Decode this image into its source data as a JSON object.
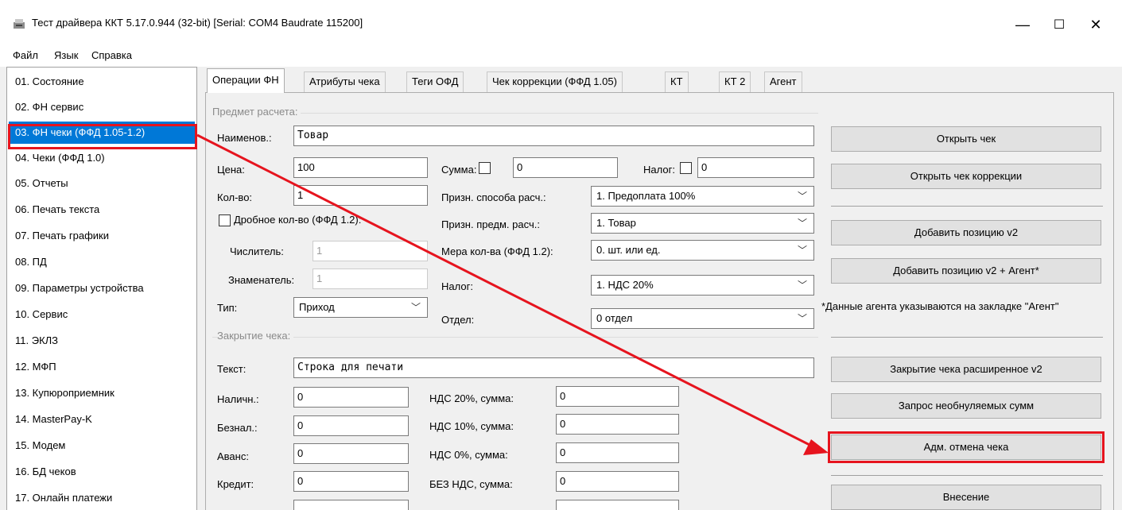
{
  "window": {
    "title": "Тест драйвера ККТ 5.17.0.944 (32-bit) [Serial: COM4 Baudrate 115200]",
    "minimize": "—",
    "maximize": "☐",
    "close": "✕"
  },
  "menu": [
    "Файл",
    "Язык",
    "Справка"
  ],
  "sidebar": [
    "01. Состояние",
    "02. ФН сервис",
    "03. ФН чеки (ФФД 1.05-1.2)",
    "04. Чеки (ФФД 1.0)",
    "05. Отчеты",
    "06. Печать текста",
    "07. Печать графики",
    "08. ПД",
    "09. Параметры устройства",
    "10. Сервис",
    "11. ЭКЛЗ",
    "12. МФП",
    "13. Купюроприемник",
    "14. MasterPay-K",
    "15. Модем",
    "16. БД чеков",
    "17. Онлайн платежи"
  ],
  "sidebar_selected": 2,
  "tabs": [
    "Операции ФН",
    "Атрибуты чека",
    "Теги ОФД",
    "Чек коррекции (ФФД 1.05)",
    "КТ",
    "КТ 2",
    "Агент"
  ],
  "subject": {
    "group": "Предмет расчета:",
    "name_label": "Наименов.:",
    "name_value": "Товар",
    "price_label": "Цена:",
    "price_value": "100",
    "sum_label": "Сумма:",
    "sum_value": "0",
    "tax_label": "Налог:",
    "tax_value": "0",
    "qty_label": "Кол-во:",
    "qty_value": "1",
    "method_label": "Призн. способа расч.:",
    "method_value": "1. Предоплата 100%",
    "fractional_label": "Дробное кол-во (ФФД 1.2):",
    "subject_sign_label": "Призн. предм. расч.:",
    "subject_sign_value": "1. Товар",
    "numerator_label": "Числитель:",
    "numerator_value": "1",
    "measure_label": "Мера кол-ва (ФФД 1.2):",
    "measure_value": "0. шт. или ед.",
    "denominator_label": "Знаменатель:",
    "denominator_value": "1",
    "vat_label": "Налог:",
    "vat_value": "1. НДС 20%",
    "type_label": "Тип:",
    "type_value": "Приход",
    "dept_label": "Отдел:",
    "dept_value": "0 отдел"
  },
  "closing": {
    "group": "Закрытие чека:",
    "text_label": "Текст:",
    "text_value": "Строка для печати",
    "cash_label": "Наличн.:",
    "cash_value": "0",
    "card_label": "Безнал.:",
    "card_value": "0",
    "advance_label": "Аванс:",
    "advance_value": "0",
    "credit_label": "Кредит:",
    "credit_value": "0",
    "vat20_label": "НДС 20%, сумма:",
    "vat20_value": "0",
    "vat10_label": "НДС 10%, сумма:",
    "vat10_value": "0",
    "vat0_label": "НДС 0%, сумма:",
    "vat0_value": "0",
    "novat_label": "БЕЗ НДС, сумма:",
    "novat_value": "0"
  },
  "buttons": {
    "open": "Открыть чек",
    "open_correction": "Открыть чек коррекции",
    "add_v2": "Добавить позицию v2",
    "add_v2_agent": "Добавить позицию v2 + Агент*",
    "agent_note": "*Данные агента указываются на закладке \"Агент\"",
    "close_ext": "Закрытие чека расширенное v2",
    "nonreset": "Запрос необнуляемых сумм",
    "cancel": "Адм. отмена чека",
    "deposit": "Внесение"
  }
}
